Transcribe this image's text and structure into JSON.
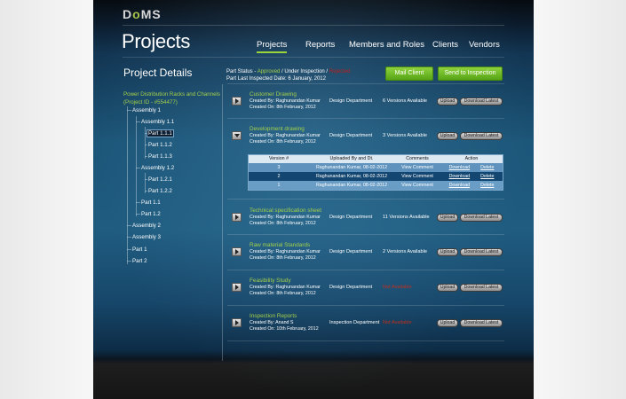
{
  "app": {
    "logo": "DoMS",
    "page_title": "Projects"
  },
  "nav": [
    {
      "label": "Projects",
      "active": true
    },
    {
      "label": "Reports"
    },
    {
      "label": "Members and Roles"
    },
    {
      "label": "Clients"
    },
    {
      "label": "Vendors"
    }
  ],
  "details": {
    "heading": "Project Details",
    "status_label": "Part Status - ",
    "status_approved": "Approved",
    "status_sep1": " / ",
    "status_under": "Under Inspection",
    "status_sep2": " / ",
    "status_rejected": "Rejected",
    "inspected_label": "Part Last Inspected Date: 6 January, 2012",
    "mail_client_label": "Mail Client",
    "send_inspection_label": "Send to Inspection"
  },
  "tree": {
    "root_line1": "Power Distribution Racks and Channels",
    "root_line2": "(Project ID - #554477)",
    "items": [
      {
        "label": "Assembly 1"
      },
      {
        "label": "Assembly 1.1"
      },
      {
        "label": "Part 1.1.1",
        "selected": true
      },
      {
        "label": "Part 1.1.2"
      },
      {
        "label": "Part 1.1.3"
      },
      {
        "label": "Assembly 1.2"
      },
      {
        "label": "Part 1.2.1"
      },
      {
        "label": "Part 1.2.2"
      },
      {
        "label": "Part 1.1"
      },
      {
        "label": "Part 1.2"
      },
      {
        "label": "Assembly 2"
      },
      {
        "label": "Assembly 3"
      },
      {
        "label": "Part 1"
      },
      {
        "label": "Part 2"
      }
    ]
  },
  "documents": [
    {
      "name": "Customer Drawing",
      "created_by": "Created By: Raghunandan Kumar",
      "created_on": "Created On: 8th February, 2012",
      "department": "Design Department",
      "versions": "6 Versions Available",
      "upload": "Upload",
      "download": "Download Latest"
    },
    {
      "name": "Development drawing",
      "created_by": "Created By: Raghunandan Kumar",
      "created_on": "Created On: 8th February, 2012",
      "department": "Design Department",
      "versions": "3 Versions Available",
      "upload": "Upload",
      "download": "Download Latest",
      "expanded": true
    },
    {
      "name": "Technical specification sheet",
      "created_by": "Created By: Raghunandan Kumar",
      "created_on": "Created On: 8th February, 2012",
      "department": "Design Department",
      "versions": "11 Versions Available",
      "upload": "Upload",
      "download": "Download Latest"
    },
    {
      "name": "Raw material Standards",
      "created_by": "Created By: Raghunandan Kumar",
      "created_on": "Created On: 8th February, 2012",
      "department": "Design Department",
      "versions": "2 Versions Available",
      "upload": "Upload",
      "download": "Download Latest"
    },
    {
      "name": "Feasibility Study",
      "created_by": "Created By: Raghunandan Kumar",
      "created_on": "Created On: 8th February, 2012",
      "department": "Design Department",
      "versions": "Not Available",
      "upload": "Upload",
      "download": "Download Latest"
    },
    {
      "name": "Inspection Reports",
      "created_by": "Created By: Anand S",
      "created_on": "Created On: 10th February, 2012",
      "department": "Inspection Department",
      "versions": "Not Available",
      "upload": "Upload",
      "download": "Download Latest"
    }
  ],
  "version_table": {
    "headers": {
      "version": "Version #",
      "uploaded": "Uploaded By and Dt.",
      "comments": "Comments",
      "action": "Action"
    },
    "rows": [
      {
        "version": "3",
        "uploaded": "Raghunandan Kumar, 08-02-2012",
        "comments": "View Comment",
        "download": "Download",
        "delete": "Delete"
      },
      {
        "version": "2",
        "uploaded": "Raghunandan Kumar, 08-02-2012",
        "comments": "View Comment",
        "download": "Download",
        "delete": "Delete"
      },
      {
        "version": "1",
        "uploaded": "Raghunandan Kumar, 08-02-2012",
        "comments": "View Comment",
        "download": "Download",
        "delete": "Delete"
      }
    ]
  },
  "colors": {
    "accent_green": "#a4d04a",
    "rejected_red": "#b8211c",
    "button_green": "#6fbd27"
  }
}
